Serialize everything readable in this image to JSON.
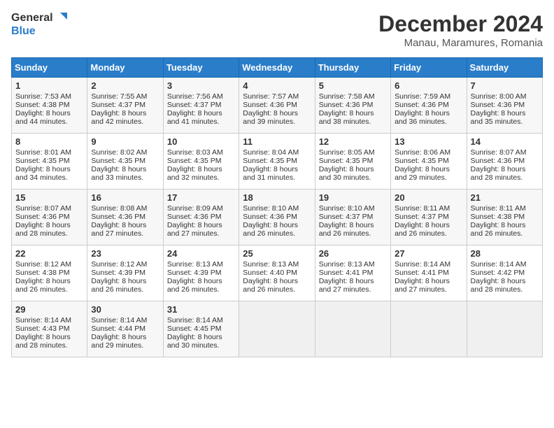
{
  "header": {
    "logo_line1": "General",
    "logo_line2": "Blue",
    "month_title": "December 2024",
    "subtitle": "Manau, Maramures, Romania"
  },
  "weekdays": [
    "Sunday",
    "Monday",
    "Tuesday",
    "Wednesday",
    "Thursday",
    "Friday",
    "Saturday"
  ],
  "weeks": [
    [
      {
        "day": "1",
        "sunrise": "Sunrise: 7:53 AM",
        "sunset": "Sunset: 4:38 PM",
        "daylight": "Daylight: 8 hours and 44 minutes."
      },
      {
        "day": "2",
        "sunrise": "Sunrise: 7:55 AM",
        "sunset": "Sunset: 4:37 PM",
        "daylight": "Daylight: 8 hours and 42 minutes."
      },
      {
        "day": "3",
        "sunrise": "Sunrise: 7:56 AM",
        "sunset": "Sunset: 4:37 PM",
        "daylight": "Daylight: 8 hours and 41 minutes."
      },
      {
        "day": "4",
        "sunrise": "Sunrise: 7:57 AM",
        "sunset": "Sunset: 4:36 PM",
        "daylight": "Daylight: 8 hours and 39 minutes."
      },
      {
        "day": "5",
        "sunrise": "Sunrise: 7:58 AM",
        "sunset": "Sunset: 4:36 PM",
        "daylight": "Daylight: 8 hours and 38 minutes."
      },
      {
        "day": "6",
        "sunrise": "Sunrise: 7:59 AM",
        "sunset": "Sunset: 4:36 PM",
        "daylight": "Daylight: 8 hours and 36 minutes."
      },
      {
        "day": "7",
        "sunrise": "Sunrise: 8:00 AM",
        "sunset": "Sunset: 4:36 PM",
        "daylight": "Daylight: 8 hours and 35 minutes."
      }
    ],
    [
      {
        "day": "8",
        "sunrise": "Sunrise: 8:01 AM",
        "sunset": "Sunset: 4:35 PM",
        "daylight": "Daylight: 8 hours and 34 minutes."
      },
      {
        "day": "9",
        "sunrise": "Sunrise: 8:02 AM",
        "sunset": "Sunset: 4:35 PM",
        "daylight": "Daylight: 8 hours and 33 minutes."
      },
      {
        "day": "10",
        "sunrise": "Sunrise: 8:03 AM",
        "sunset": "Sunset: 4:35 PM",
        "daylight": "Daylight: 8 hours and 32 minutes."
      },
      {
        "day": "11",
        "sunrise": "Sunrise: 8:04 AM",
        "sunset": "Sunset: 4:35 PM",
        "daylight": "Daylight: 8 hours and 31 minutes."
      },
      {
        "day": "12",
        "sunrise": "Sunrise: 8:05 AM",
        "sunset": "Sunset: 4:35 PM",
        "daylight": "Daylight: 8 hours and 30 minutes."
      },
      {
        "day": "13",
        "sunrise": "Sunrise: 8:06 AM",
        "sunset": "Sunset: 4:35 PM",
        "daylight": "Daylight: 8 hours and 29 minutes."
      },
      {
        "day": "14",
        "sunrise": "Sunrise: 8:07 AM",
        "sunset": "Sunset: 4:36 PM",
        "daylight": "Daylight: 8 hours and 28 minutes."
      }
    ],
    [
      {
        "day": "15",
        "sunrise": "Sunrise: 8:07 AM",
        "sunset": "Sunset: 4:36 PM",
        "daylight": "Daylight: 8 hours and 28 minutes."
      },
      {
        "day": "16",
        "sunrise": "Sunrise: 8:08 AM",
        "sunset": "Sunset: 4:36 PM",
        "daylight": "Daylight: 8 hours and 27 minutes."
      },
      {
        "day": "17",
        "sunrise": "Sunrise: 8:09 AM",
        "sunset": "Sunset: 4:36 PM",
        "daylight": "Daylight: 8 hours and 27 minutes."
      },
      {
        "day": "18",
        "sunrise": "Sunrise: 8:10 AM",
        "sunset": "Sunset: 4:36 PM",
        "daylight": "Daylight: 8 hours and 26 minutes."
      },
      {
        "day": "19",
        "sunrise": "Sunrise: 8:10 AM",
        "sunset": "Sunset: 4:37 PM",
        "daylight": "Daylight: 8 hours and 26 minutes."
      },
      {
        "day": "20",
        "sunrise": "Sunrise: 8:11 AM",
        "sunset": "Sunset: 4:37 PM",
        "daylight": "Daylight: 8 hours and 26 minutes."
      },
      {
        "day": "21",
        "sunrise": "Sunrise: 8:11 AM",
        "sunset": "Sunset: 4:38 PM",
        "daylight": "Daylight: 8 hours and 26 minutes."
      }
    ],
    [
      {
        "day": "22",
        "sunrise": "Sunrise: 8:12 AM",
        "sunset": "Sunset: 4:38 PM",
        "daylight": "Daylight: 8 hours and 26 minutes."
      },
      {
        "day": "23",
        "sunrise": "Sunrise: 8:12 AM",
        "sunset": "Sunset: 4:39 PM",
        "daylight": "Daylight: 8 hours and 26 minutes."
      },
      {
        "day": "24",
        "sunrise": "Sunrise: 8:13 AM",
        "sunset": "Sunset: 4:39 PM",
        "daylight": "Daylight: 8 hours and 26 minutes."
      },
      {
        "day": "25",
        "sunrise": "Sunrise: 8:13 AM",
        "sunset": "Sunset: 4:40 PM",
        "daylight": "Daylight: 8 hours and 26 minutes."
      },
      {
        "day": "26",
        "sunrise": "Sunrise: 8:13 AM",
        "sunset": "Sunset: 4:41 PM",
        "daylight": "Daylight: 8 hours and 27 minutes."
      },
      {
        "day": "27",
        "sunrise": "Sunrise: 8:14 AM",
        "sunset": "Sunset: 4:41 PM",
        "daylight": "Daylight: 8 hours and 27 minutes."
      },
      {
        "day": "28",
        "sunrise": "Sunrise: 8:14 AM",
        "sunset": "Sunset: 4:42 PM",
        "daylight": "Daylight: 8 hours and 28 minutes."
      }
    ],
    [
      {
        "day": "29",
        "sunrise": "Sunrise: 8:14 AM",
        "sunset": "Sunset: 4:43 PM",
        "daylight": "Daylight: 8 hours and 28 minutes."
      },
      {
        "day": "30",
        "sunrise": "Sunrise: 8:14 AM",
        "sunset": "Sunset: 4:44 PM",
        "daylight": "Daylight: 8 hours and 29 minutes."
      },
      {
        "day": "31",
        "sunrise": "Sunrise: 8:14 AM",
        "sunset": "Sunset: 4:45 PM",
        "daylight": "Daylight: 8 hours and 30 minutes."
      },
      null,
      null,
      null,
      null
    ]
  ]
}
